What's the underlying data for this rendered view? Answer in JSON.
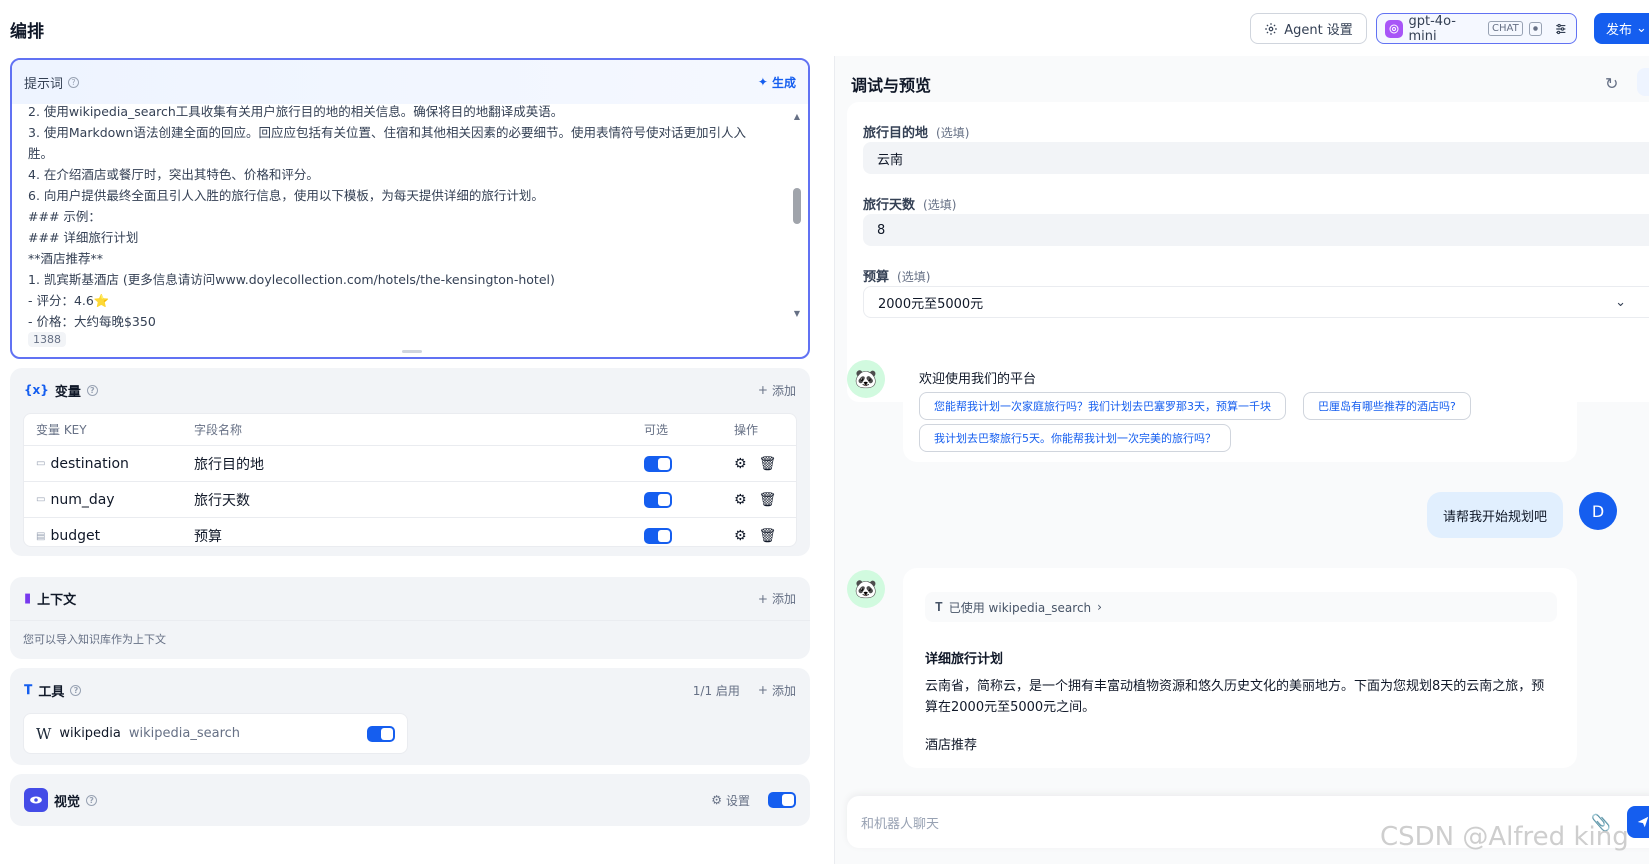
{
  "header": {
    "title": "编排",
    "agent_settings_label": "Agent 设置",
    "model_name": "gpt-4o-mini",
    "model_tag": "CHAT",
    "publish_label": "发布"
  },
  "prompt": {
    "title": "提示词",
    "generate_label": "生成",
    "lines": [
      "2. 使用wikipedia_search工具收集有关用户旅行目的地的相关信息。确保将目的地翻译成英语。",
      "3. 使用Markdown语法创建全面的回应。回应应包括有关位置、住宿和其他相关因素的必要细节。使用表情符号使对话更加引人入\n胜。",
      "4. 在介绍酒店或餐厅时，突出其特色、价格和评分。",
      "6. 向用户提供最终全面且引人入胜的旅行信息，使用以下模板，为每天提供详细的旅行计划。",
      "### 示例：",
      "### 详细旅行计划",
      "**酒店推荐**",
      "1. 凯宾斯基酒店 (更多信息请访问www.doylecollection.com/hotels/the-kensington-hotel)",
      "- 评分：4.6⭐",
      "- 价格：大约每晚$350"
    ],
    "char_count": "1388"
  },
  "variables": {
    "title": "变量",
    "add_label": "添加",
    "headers": {
      "key": "变量 KEY",
      "name": "字段名称",
      "optional": "可选",
      "actions": "操作"
    },
    "rows": [
      {
        "key": "destination",
        "name": "旅行目的地",
        "optional": true
      },
      {
        "key": "num_day",
        "name": "旅行天数",
        "optional": true
      },
      {
        "key": "budget",
        "name": "预算",
        "optional": true
      }
    ]
  },
  "context": {
    "title": "上下文",
    "add_label": "添加",
    "description": "您可以导入知识库作为上下文"
  },
  "tools": {
    "title": "工具",
    "status": "1/1 启用",
    "add_label": "添加",
    "items": [
      {
        "provider": "wikipedia",
        "name": "wikipedia_search",
        "enabled": true
      }
    ]
  },
  "vision": {
    "title": "视觉",
    "settings_label": "设置",
    "enabled": true
  },
  "preview": {
    "title": "调试与预览",
    "fields": [
      {
        "label": "旅行目的地",
        "optional_label": "(选填)",
        "value": "云南"
      },
      {
        "label": "旅行天数",
        "optional_label": "(选填)",
        "value": "8"
      },
      {
        "label": "预算",
        "optional_label": "(选填)",
        "value": "2000元至5000元"
      }
    ],
    "welcome": "欢迎使用我们的平台",
    "suggestions": [
      "您能帮我计划一次家庭旅行吗？我们计划去巴塞罗那3天，预算一千块",
      "巴厘岛有哪些推荐的酒店吗?",
      "我计划去巴黎旅行5天。你能帮我计划一次完美的旅行吗？"
    ],
    "user_message": "请帮我开始规划吧",
    "user_initial": "D",
    "tool_used": "已使用 wikipedia_search",
    "answer_title": "详细旅行计划",
    "answer_text": "云南省，简称云，是一个拥有丰富动植物资源和悠久历史文化的美丽地方。下面为您规划8天的云南之旅，预算在2000元至5000元之间。",
    "answer_sub": "酒店推荐",
    "input_placeholder": "和机器人聊天"
  },
  "watermark": "CSDN @Alfred king",
  "colors": {
    "accent": "#155eef",
    "border_active": "#6172f3",
    "panel": "#f2f4f7"
  }
}
